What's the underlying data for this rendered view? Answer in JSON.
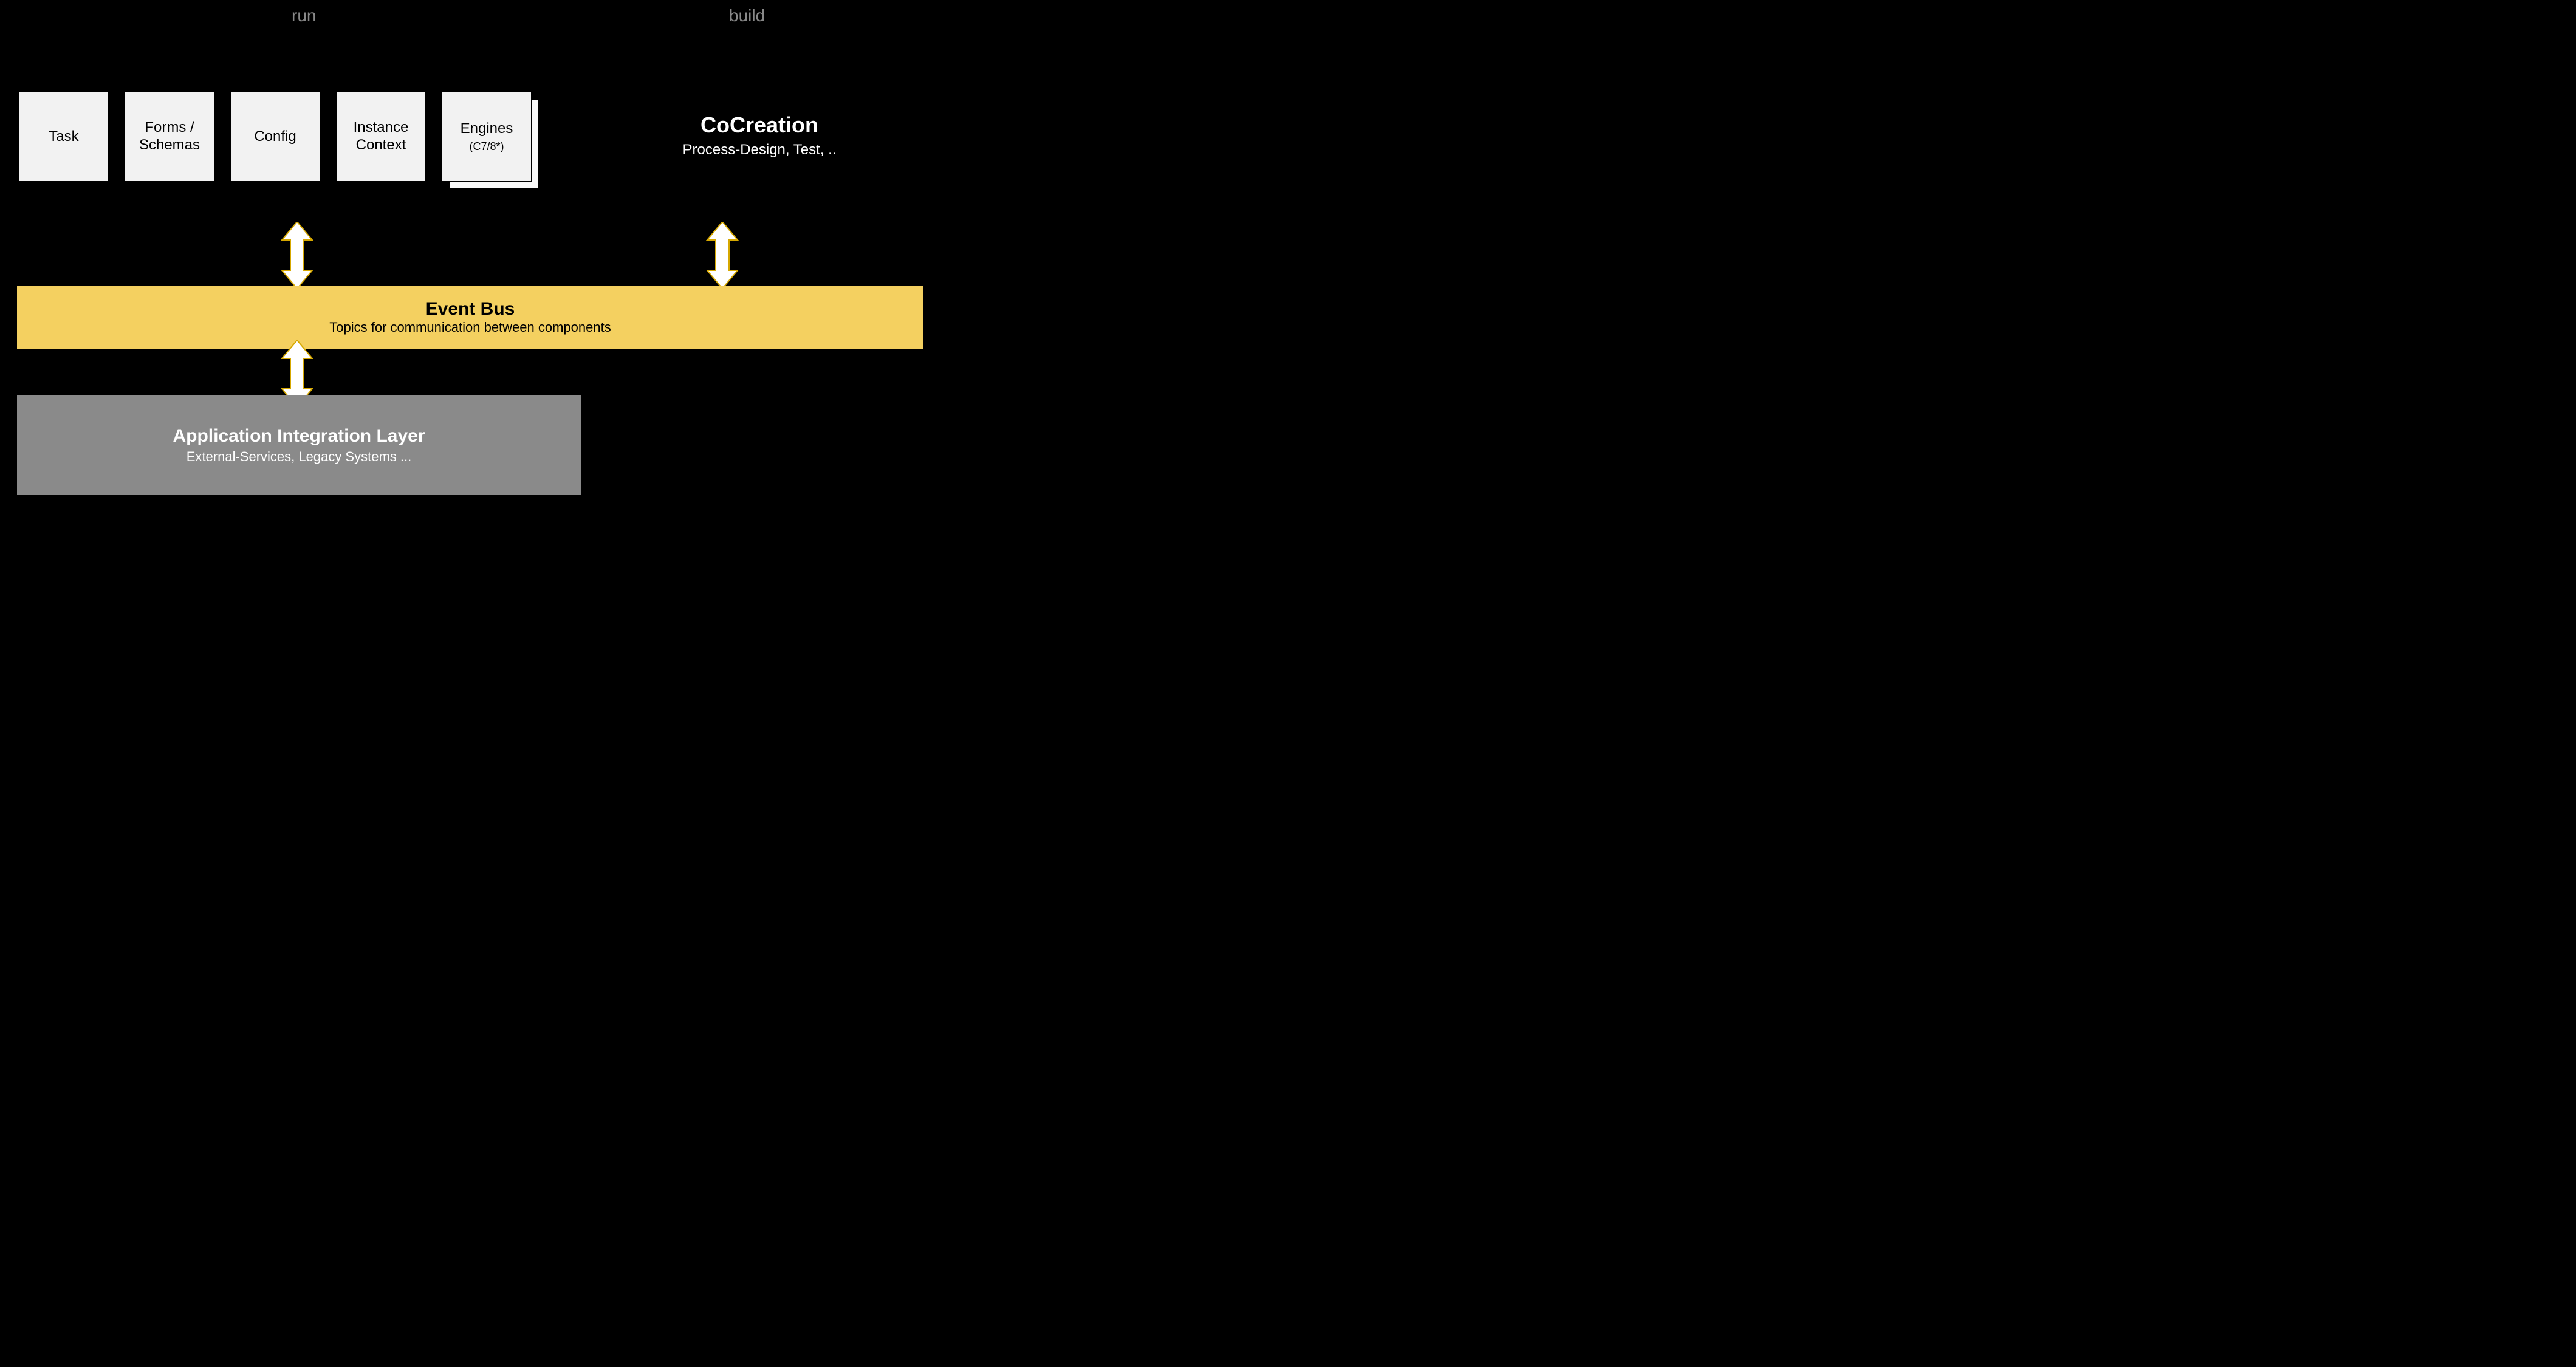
{
  "sections": {
    "run": "run",
    "build": "build"
  },
  "components": [
    {
      "label": "Task",
      "sub": ""
    },
    {
      "label": "Forms / Schemas",
      "sub": ""
    },
    {
      "label": "Config",
      "sub": ""
    },
    {
      "label": "Instance Context",
      "sub": ""
    },
    {
      "label": "Engines",
      "sub": "(C7/8*)"
    }
  ],
  "cocreation": {
    "title": "CoCreation",
    "subtitle": "Process-Design, Test, .."
  },
  "event_bus": {
    "title": "Event Bus",
    "subtitle": "Topics for communication between components"
  },
  "app_layer": {
    "title": "Application Integration Layer",
    "subtitle": "External-Services, Legacy Systems ..."
  },
  "colors": {
    "event_bus_bg": "#f4d060",
    "app_layer_bg": "#8a8a8a",
    "box_bg": "#f2f2f2"
  }
}
